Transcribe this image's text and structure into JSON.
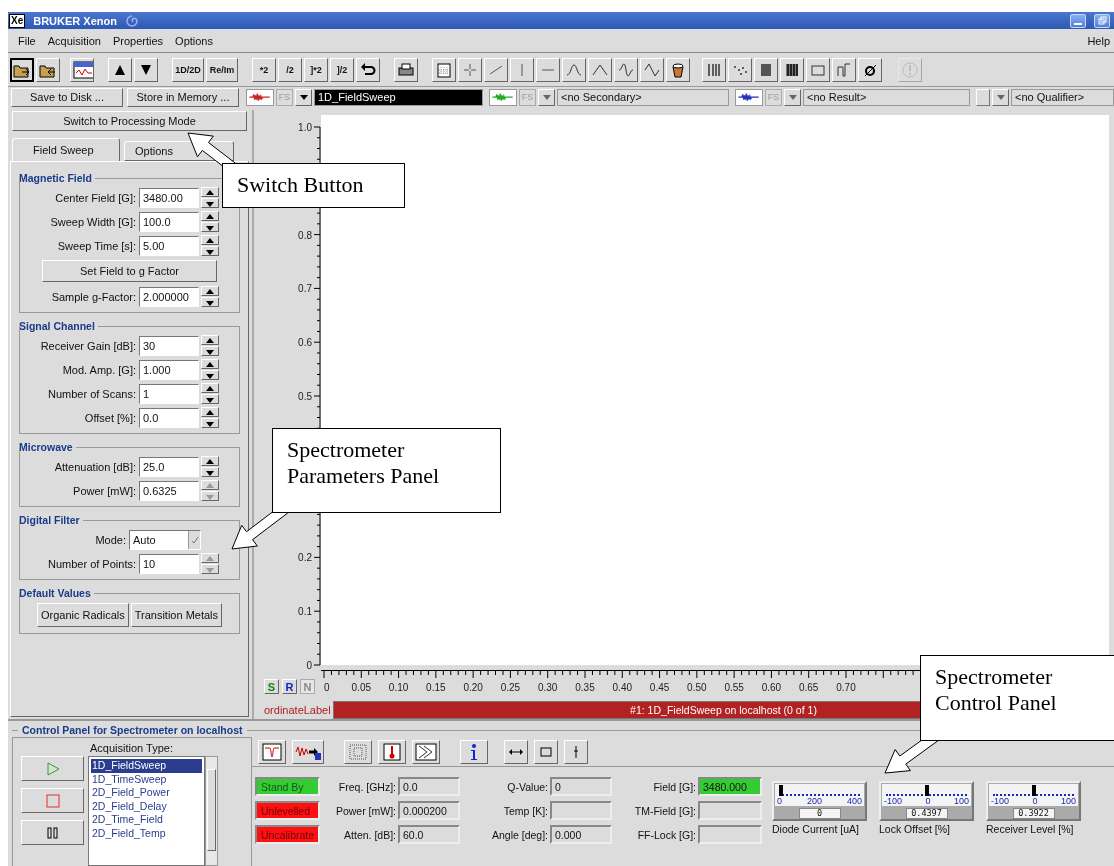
{
  "window": {
    "icon_text": "Xe",
    "title": "BRUKER Xenon"
  },
  "menu": {
    "items": [
      "File",
      "Acquisition",
      "Properties",
      "Options"
    ],
    "help": "Help"
  },
  "toolbar": {
    "text_buttons": [
      "1D/2D",
      "Re/Im",
      "*2",
      "/2",
      "]*2",
      "]/2"
    ],
    "alert_disabled": true
  },
  "storage_buttons": [
    "Save to Disk ...",
    "Store in Memory ..."
  ],
  "dataset_selectors": [
    {
      "color": "#cc2222",
      "tag": "FS",
      "value": "1D_FieldSweep",
      "selected": true
    },
    {
      "color": "#22aa22",
      "tag": "FS",
      "value": "<no Secondary>",
      "selected": false
    },
    {
      "color": "#2233bb",
      "tag": "FS",
      "value": "<no Result>",
      "selected": false
    },
    {
      "value": "<no Qualifier>",
      "selected": false
    }
  ],
  "mode_button": "Switch to Processing Mode",
  "tabs": [
    {
      "label": "Field Sweep",
      "selected": true
    },
    {
      "label": "Options",
      "selected": false
    }
  ],
  "parameter_groups": [
    {
      "title": "Magnetic Field",
      "rows": [
        {
          "kind": "spin",
          "label": "Center Field [G]:",
          "value": "3480.00",
          "disabled": false
        },
        {
          "kind": "spin",
          "label": "Sweep Width [G]:",
          "value": "100.0",
          "disabled": false
        },
        {
          "kind": "spin",
          "label": "Sweep Time [s]:",
          "value": "5.00",
          "disabled": false
        },
        {
          "kind": "button",
          "label": "Set Field to g Factor"
        },
        {
          "kind": "spin",
          "label": "Sample g-Factor:",
          "value": "2.000000",
          "disabled": false
        }
      ]
    },
    {
      "title": "Signal Channel",
      "rows": [
        {
          "kind": "spin",
          "label": "Receiver Gain [dB]:",
          "value": "30",
          "disabled": false
        },
        {
          "kind": "spin",
          "label": "Mod. Amp. [G]:",
          "value": "1.000",
          "disabled": false
        },
        {
          "kind": "spin",
          "label": "Number of Scans:",
          "value": "1",
          "disabled": false
        },
        {
          "kind": "spin",
          "label": "Offset [%]:",
          "value": "0.0",
          "disabled": false
        }
      ]
    },
    {
      "title": "Microwave",
      "rows": [
        {
          "kind": "spin",
          "label": "Attenuation [dB]:",
          "value": "25.0",
          "disabled": false
        },
        {
          "kind": "spin",
          "label": "Power [mW]:",
          "value": "0.6325",
          "disabled": true
        }
      ]
    },
    {
      "title": "Digital Filter",
      "rows": [
        {
          "kind": "select",
          "label": "Mode:",
          "value": "Auto"
        },
        {
          "kind": "spin",
          "label": "Number of Points:",
          "value": "10",
          "disabled": true
        }
      ]
    },
    {
      "title": "Default Values",
      "rows": [
        {
          "kind": "buttons",
          "labels": [
            "Organic Radicals",
            "Transition Metals"
          ]
        }
      ]
    }
  ],
  "plot": {
    "chart_data": {
      "type": "line",
      "ylabel": "ordinateLabel",
      "xlim": [
        0,
        1.05
      ],
      "ylim": [
        0,
        1
      ],
      "xticks": [
        {
          "value": 0,
          "label": "0"
        },
        {
          "value": 0.05,
          "label": "0.05"
        },
        {
          "value": 0.1,
          "label": "0.10"
        },
        {
          "value": 0.15,
          "label": "0.15"
        },
        {
          "value": 0.2,
          "label": "0.20"
        },
        {
          "value": 0.25,
          "label": "0.25"
        },
        {
          "value": 0.3,
          "label": "0.30"
        },
        {
          "value": 0.35,
          "label": "0.35"
        },
        {
          "value": 0.4,
          "label": "0.40"
        },
        {
          "value": 0.45,
          "label": "0.45"
        },
        {
          "value": 0.5,
          "label": "0.50"
        },
        {
          "value": 0.55,
          "label": "0.55"
        },
        {
          "value": 0.6,
          "label": "0.60"
        },
        {
          "value": 0.65,
          "label": "0.65"
        },
        {
          "value": 0.7,
          "label": "0.70"
        }
      ],
      "yticks": [
        {
          "value": 0,
          "label": "0"
        },
        {
          "value": 0.1,
          "label": "0.1"
        },
        {
          "value": 0.2,
          "label": "0.2"
        },
        {
          "value": 0.5,
          "label": "0.5"
        },
        {
          "value": 0.6,
          "label": "0.6"
        },
        {
          "value": 0.7,
          "label": "0.7"
        },
        {
          "value": 0.8,
          "label": "0.8"
        },
        {
          "value": 1,
          "label": "1.0"
        }
      ]
    },
    "view_buttons": [
      {
        "label": "S",
        "color": "#118811",
        "disabled": false
      },
      {
        "label": "R",
        "color": "#1122cc",
        "disabled": false
      },
      {
        "label": "N",
        "color": "#888888",
        "disabled": true
      }
    ],
    "status_bar": "#1: 1D_FieldSweep on localhost (0 of 1)"
  },
  "control_panel": {
    "title": "Control Panel for Spectrometer on localhost",
    "acquisition_label": "Acquisition Type:",
    "acquisition_types": [
      {
        "label": "1D_FieldSweep",
        "selected": true
      },
      {
        "label": "1D_TimeSweep",
        "selected": false
      },
      {
        "label": "2D_Field_Power",
        "selected": false
      },
      {
        "label": "2D_Field_Delay",
        "selected": false
      },
      {
        "label": "2D_Time_Field",
        "selected": false
      },
      {
        "label": "2D_Field_Temp",
        "selected": false
      }
    ],
    "indicators": [
      {
        "label": "Stand By",
        "color": "#33cc33"
      },
      {
        "label": "Unlevelled",
        "color": "#ff1111"
      },
      {
        "label": "Uncalibrate",
        "color": "#ff1111"
      }
    ],
    "readouts": [
      [
        {
          "label": "Freq. [GHz]:",
          "value": "0.0",
          "highlighted": false
        },
        {
          "label": "Power [mW]:",
          "value": "0.000200",
          "highlighted": false
        },
        {
          "label": "Atten. [dB]:",
          "value": "60.0",
          "highlighted": false
        }
      ],
      [
        {
          "label": "Q-Value:",
          "value": "0",
          "highlighted": false
        },
        {
          "label": "Temp [K]:",
          "highlighted": false
        },
        {
          "label": "Angle [deg]:",
          "value": "0.000",
          "highlighted": false
        }
      ],
      [
        {
          "label": "Field [G]:",
          "value": "3480.000",
          "highlighted": true
        },
        {
          "label": "TM-Field [G]:",
          "highlighted": false
        },
        {
          "label": "FF-Lock [G]:",
          "highlighted": false
        }
      ]
    ],
    "meters": [
      {
        "scale": [
          "0",
          "200",
          "400"
        ],
        "level": 0,
        "reading": "0",
        "label": "Diode Current [uA]"
      },
      {
        "scale": [
          "-100",
          "0",
          "100"
        ],
        "level": 0.5,
        "reading": "0.4397",
        "label": "Lock Offset [%]"
      },
      {
        "scale": [
          "-100",
          "0",
          "100"
        ],
        "level": 0.5,
        "reading": "0.3922",
        "label": "Receiver Level [%]"
      }
    ]
  },
  "annotations": [
    {
      "text": "Switch Button"
    },
    {
      "text": "Spectrometer Parameters Panel"
    },
    {
      "text": "Spectrometer Control Panel"
    }
  ]
}
